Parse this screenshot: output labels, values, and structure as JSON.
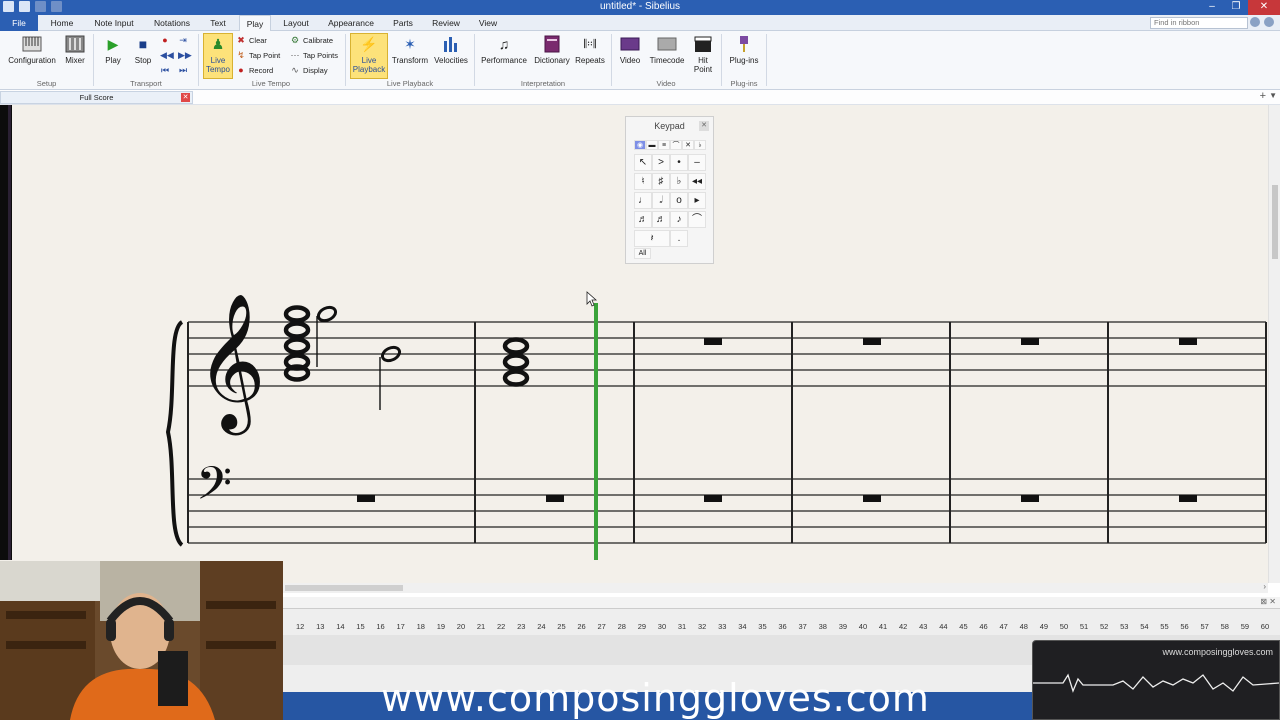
{
  "window": {
    "title": "untitled* - Sibelius",
    "controls": [
      "–",
      "❐",
      "✕"
    ]
  },
  "tabs": [
    {
      "label": "File"
    },
    {
      "label": "Home"
    },
    {
      "label": "Note Input"
    },
    {
      "label": "Notations"
    },
    {
      "label": "Text"
    },
    {
      "label": "Play"
    },
    {
      "label": "Layout"
    },
    {
      "label": "Appearance"
    },
    {
      "label": "Parts"
    },
    {
      "label": "Review"
    },
    {
      "label": "View"
    }
  ],
  "find_placeholder": "Find in ribbon",
  "ribbon": {
    "setup": {
      "label": "Setup",
      "configuration": "Configuration",
      "mixer": "Mixer"
    },
    "transport": {
      "label": "Transport",
      "play": "Play",
      "stop": "Stop"
    },
    "live_tempo": {
      "label": "Live Tempo",
      "button": "Live Tempo",
      "clear": "Clear",
      "tap_point": "Tap Point",
      "record": "Record",
      "calibrate": "Calibrate",
      "tap_points": "Tap Points",
      "display": "Display"
    },
    "live_playback": {
      "label": "Live Playback",
      "button": "Live Playback",
      "transform": "Transform",
      "velocities": "Velocities"
    },
    "interpretation": {
      "label": "Interpretation",
      "performance": "Performance",
      "dictionary": "Dictionary",
      "repeats": "Repeats"
    },
    "video": {
      "label": "Video",
      "video": "Video",
      "timecode": "Timecode",
      "hit_point": "Hit Point"
    },
    "plugins": {
      "label": "Plug-ins",
      "button": "Plug-ins"
    }
  },
  "score_tab": {
    "label": "Full Score"
  },
  "keypad": {
    "title": "Keypad",
    "layouts": [
      "1",
      "2",
      "3",
      "4",
      "All"
    ],
    "active_layout": "1"
  },
  "timeline": {
    "bars": [
      "12",
      "13",
      "14",
      "15",
      "16",
      "17",
      "18",
      "19",
      "20",
      "21",
      "22",
      "23",
      "24",
      "25",
      "26",
      "27",
      "28",
      "29",
      "30",
      "31",
      "32",
      "33",
      "34",
      "35",
      "36",
      "37",
      "38",
      "39",
      "40",
      "41",
      "42",
      "43",
      "44",
      "45",
      "46",
      "47",
      "48",
      "49",
      "50",
      "51",
      "52",
      "53",
      "54",
      "55",
      "56",
      "57",
      "58",
      "59",
      "60"
    ]
  },
  "overlay": {
    "website": "www.composinggloves.com",
    "watermark": "www.composinggloves.com"
  },
  "colors": {
    "accent": "#2b5fb3",
    "highlight": "#fde27a",
    "playback_line": "#3aa33a",
    "banner": "#2656a3"
  }
}
